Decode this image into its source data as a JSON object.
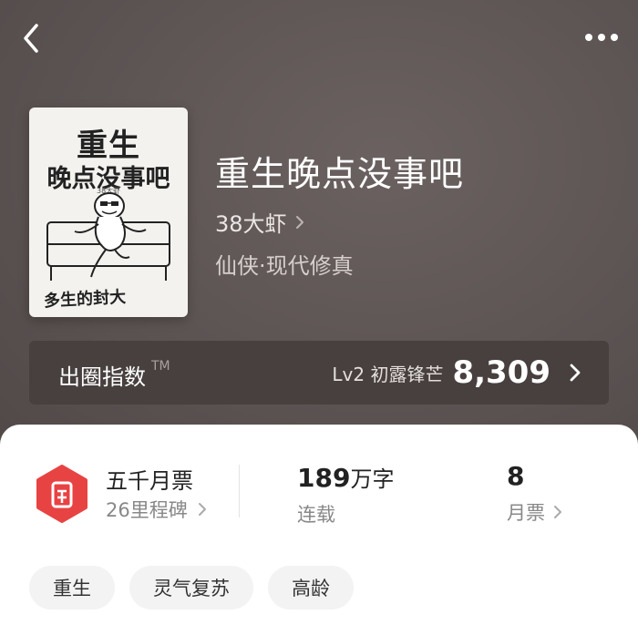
{
  "header": {
    "back_icon": "chevron-left-icon",
    "more_icon": "more-dots-icon"
  },
  "cover": {
    "title_line1": "重生",
    "title_line2": "晚点没事吧",
    "author_mark": "38大虾",
    "signature": "多生的封大"
  },
  "book": {
    "title": "重生晚点没事吧",
    "author": "38大虾",
    "genre": "仙侠·现代修真"
  },
  "index_bar": {
    "label": "出圈指数",
    "tm": "TM",
    "level": "Lv2 初露锋芒",
    "value": "8,309"
  },
  "milestone": {
    "title": "五千月票",
    "subtitle": "26里程碑"
  },
  "stats": {
    "words": {
      "number": "189",
      "unit": "万字",
      "label": "连载"
    },
    "votes": {
      "number": "8",
      "label": "月票"
    }
  },
  "tags": [
    "重生",
    "灵气复苏",
    "高龄"
  ],
  "colors": {
    "hero_bg": "#5c5453",
    "index_bar_bg": "#47403f",
    "milestone_red": "#e84343",
    "card_bg": "#ffffff"
  }
}
